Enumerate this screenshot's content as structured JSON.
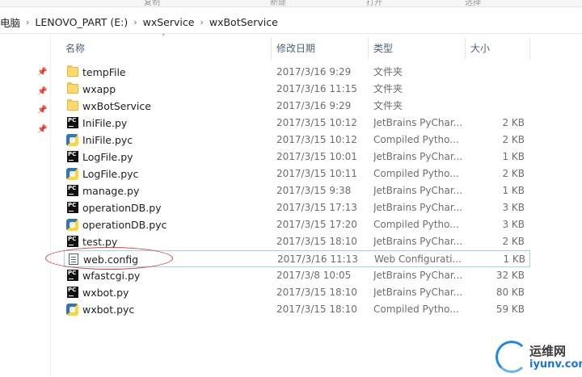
{
  "ribbon": {
    "labels": [
      "复制",
      "新建",
      "打开",
      "选择"
    ]
  },
  "breadcrumb": {
    "items": [
      "电脑",
      "LENOVO_PART (E:)",
      "wxService",
      "wxBotService"
    ],
    "separator": "›"
  },
  "columns": {
    "name": "名称",
    "date": "修改日期",
    "type": "类型",
    "size": "大小"
  },
  "sort_indicator": "˄",
  "files": [
    {
      "name": "tempFile",
      "date": "2017/3/16 9:29",
      "type": "文件夹",
      "size": "",
      "icon": "folder-icon"
    },
    {
      "name": "wxapp",
      "date": "2017/3/16 11:15",
      "type": "文件夹",
      "size": "",
      "icon": "folder-icon"
    },
    {
      "name": "wxBotService",
      "date": "2017/3/16 9:29",
      "type": "文件夹",
      "size": "",
      "icon": "folder-icon"
    },
    {
      "name": "IniFile.py",
      "date": "2017/3/15 10:12",
      "type": "JetBrains PyChar...",
      "size": "2 KB",
      "icon": "pycharm-file-icon"
    },
    {
      "name": "IniFile.pyc",
      "date": "2017/3/15 10:12",
      "type": "Compiled Pytho...",
      "size": "2 KB",
      "icon": "python-compiled-icon"
    },
    {
      "name": "LogFile.py",
      "date": "2017/3/15 10:01",
      "type": "JetBrains PyChar...",
      "size": "1 KB",
      "icon": "pycharm-file-icon"
    },
    {
      "name": "LogFile.pyc",
      "date": "2017/3/15 10:11",
      "type": "Compiled Pytho...",
      "size": "2 KB",
      "icon": "python-compiled-icon"
    },
    {
      "name": "manage.py",
      "date": "2017/3/15 9:38",
      "type": "JetBrains PyChar...",
      "size": "1 KB",
      "icon": "pycharm-file-icon"
    },
    {
      "name": "operationDB.py",
      "date": "2017/3/15 17:13",
      "type": "JetBrains PyChar...",
      "size": "3 KB",
      "icon": "pycharm-file-icon"
    },
    {
      "name": "operationDB.pyc",
      "date": "2017/3/15 17:20",
      "type": "Compiled Pytho...",
      "size": "3 KB",
      "icon": "python-compiled-icon"
    },
    {
      "name": "test.py",
      "date": "2017/3/15 18:10",
      "type": "JetBrains PyChar...",
      "size": "2 KB",
      "icon": "pycharm-file-icon"
    },
    {
      "name": "web.config",
      "date": "2017/3/16 11:13",
      "type": "Web Configurati...",
      "size": "1 KB",
      "icon": "config-file-icon",
      "selected": true
    },
    {
      "name": "wfastcgi.py",
      "date": "2017/3/8 10:05",
      "type": "JetBrains PyChar...",
      "size": "32 KB",
      "icon": "pycharm-file-icon"
    },
    {
      "name": "wxbot.py",
      "date": "2017/3/15 18:10",
      "type": "JetBrains PyChar...",
      "size": "80 KB",
      "icon": "pycharm-file-icon"
    },
    {
      "name": "wxbot.pyc",
      "date": "2017/3/15 18:10",
      "type": "Compiled Pytho...",
      "size": "59 KB",
      "icon": "python-compiled-icon"
    }
  ],
  "watermark": {
    "text_cn": "运维网",
    "text_en": "iyunv.com"
  },
  "colors": {
    "selection_border": "#99d1ff",
    "annotation": "#e53935",
    "folder": "#ffd969",
    "header_text": "#4c607a"
  }
}
